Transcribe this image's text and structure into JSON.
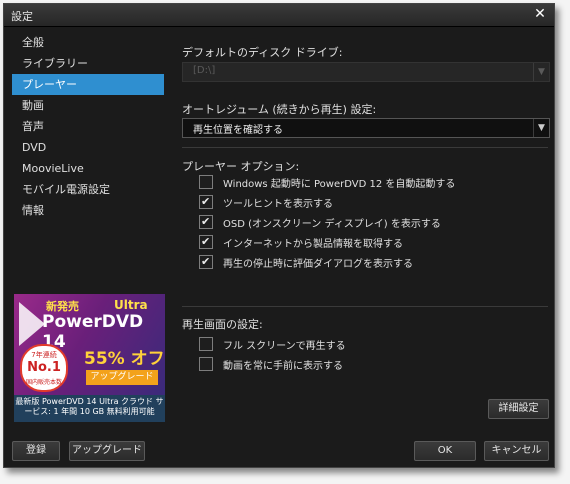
{
  "window": {
    "title": "設定",
    "close": "✕"
  },
  "sidebar": {
    "items": [
      {
        "label": "全般"
      },
      {
        "label": "ライブラリー"
      },
      {
        "label": "プレーヤー"
      },
      {
        "label": "動画"
      },
      {
        "label": "音声"
      },
      {
        "label": "DVD"
      },
      {
        "label": "MoovieLive"
      },
      {
        "label": "モバイル電源設定"
      },
      {
        "label": "情報"
      }
    ],
    "active_index": 2
  },
  "ad": {
    "new": "新発売",
    "ultra": "Ultra",
    "title": "PowerDVD 14",
    "badge_top": "7年連続",
    "badge_main": "No.1",
    "badge_bottom": "国内販売本数",
    "discount": "55% オフ",
    "button": "アップグレード",
    "caption": "最新版 PowerDVD 14 Ultra クラウド サービス: 1 年間 10 GB 無料利用可能"
  },
  "main": {
    "drive_label": "デフォルトのディスク ドライブ:",
    "drive_value": "[D:\\]",
    "resume_label": "オートレジューム (続きから再生) 設定:",
    "resume_value": "再生位置を確認する",
    "options_label": "プレーヤー オプション:",
    "options": [
      {
        "label": "Windows 起動時に PowerDVD 12 を自動起動する",
        "checked": false
      },
      {
        "label": "ツールヒントを表示する",
        "checked": true
      },
      {
        "label": "OSD (オンスクリーン ディスプレイ) を表示する",
        "checked": true
      },
      {
        "label": "インターネットから製品情報を取得する",
        "checked": true
      },
      {
        "label": "再生の停止時に評価ダイアログを表示する",
        "checked": true
      }
    ],
    "screen_label": "再生画面の設定:",
    "screen_options": [
      {
        "label": "フル スクリーンで再生する",
        "checked": false
      },
      {
        "label": "動画を常に手前に表示する",
        "checked": false
      }
    ],
    "advanced_button": "詳細設定"
  },
  "footer": {
    "register": "登録",
    "upgrade": "アップグレード",
    "ok": "OK",
    "cancel": "キャンセル"
  },
  "colors": {
    "accent": "#2f8fd0",
    "background": "#1b1b1b"
  }
}
